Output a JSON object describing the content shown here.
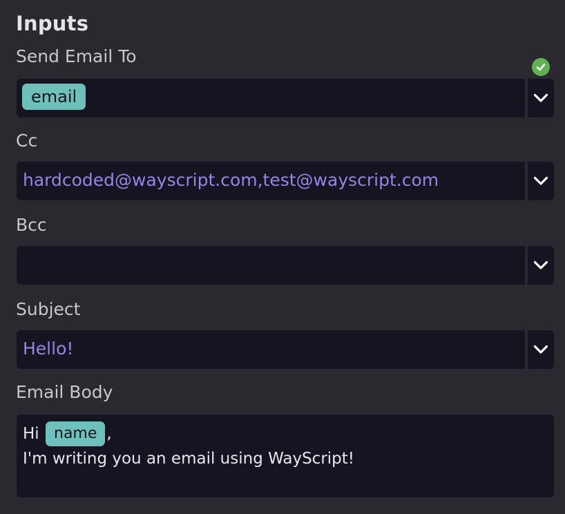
{
  "section": {
    "title": "Inputs"
  },
  "send_to": {
    "label": "Send Email To",
    "tag": "email",
    "status": "valid"
  },
  "cc": {
    "label": "Cc",
    "value": "hardcoded@wayscript.com,test@wayscript.com"
  },
  "bcc": {
    "label": "Bcc",
    "value": ""
  },
  "subject": {
    "label": "Subject",
    "value": "Hello!"
  },
  "body": {
    "label": "Email Body",
    "greeting": "Hi",
    "tag": "name",
    "after_tag": ",",
    "line2": "I'm writing you an email using WayScript!"
  },
  "colors": {
    "background": "#2a292f",
    "field": "#171421",
    "value_text": "#9a83e6",
    "tag": "#6ec1bb",
    "check": "#5fb254"
  }
}
